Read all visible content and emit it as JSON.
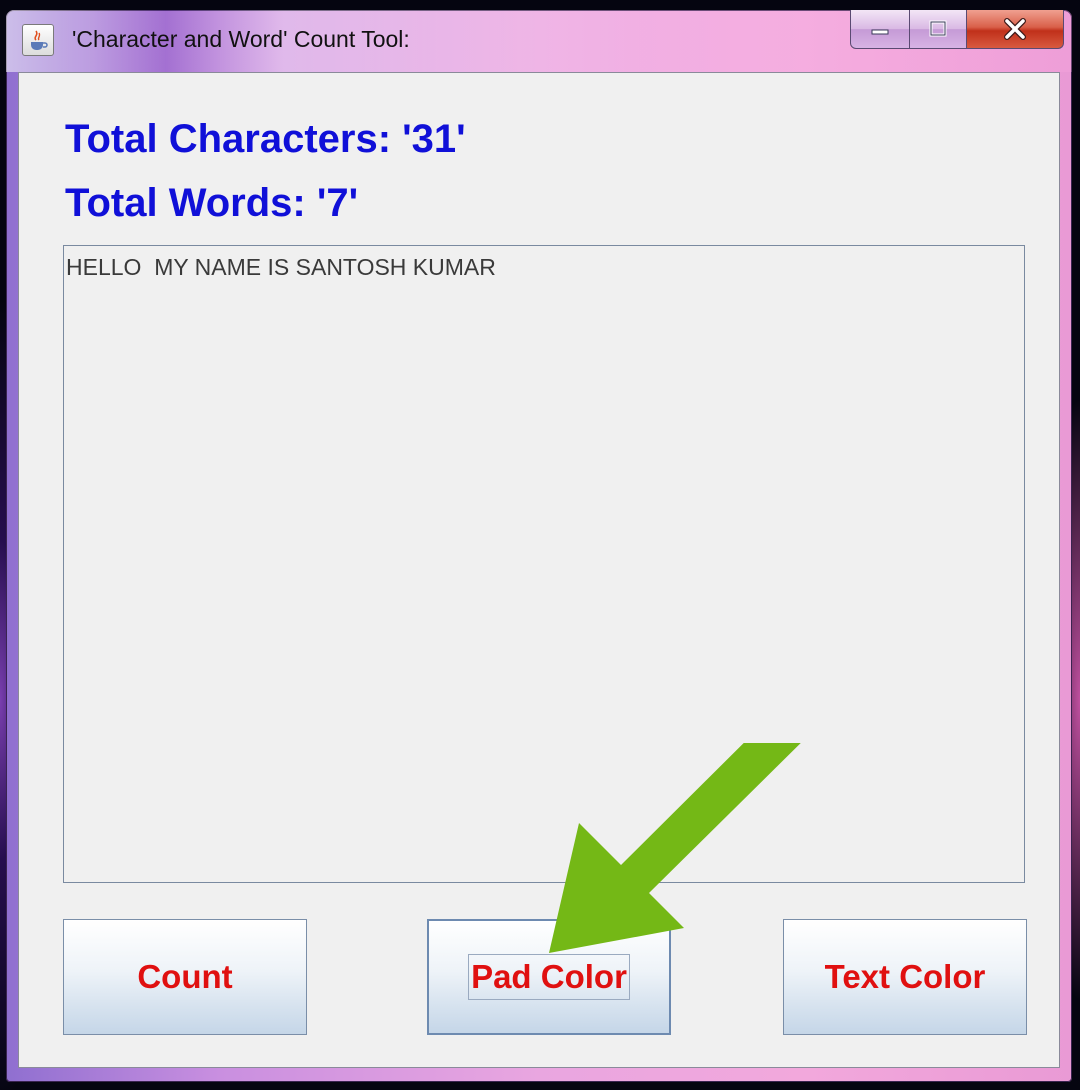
{
  "window": {
    "title": "'Character and Word' Count Tool:",
    "icon": "java-cup-icon"
  },
  "stats": {
    "total_characters": "Total Characters: '31'",
    "total_words": "Total Words: '7'"
  },
  "editor": {
    "value": "HELLO  MY NAME IS SANTOSH KUMAR"
  },
  "buttons": {
    "count": "Count",
    "pad_color": "Pad Color",
    "text_color": "Text Color"
  },
  "colors": {
    "stat_text": "#1010d8",
    "button_text": "#e01010",
    "arrow": "#74b816"
  }
}
